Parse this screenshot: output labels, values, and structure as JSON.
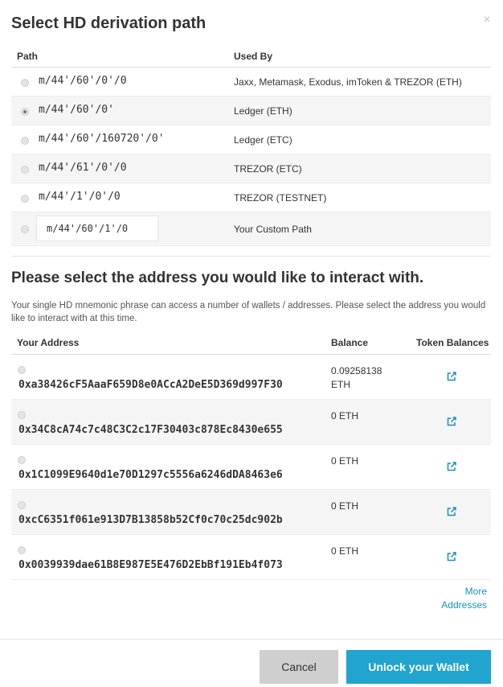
{
  "modal": {
    "title": "Select HD derivation path",
    "close_glyph": "×"
  },
  "path_table": {
    "headers": {
      "path": "Path",
      "used_by": "Used By"
    },
    "rows": [
      {
        "path": "m/44'/60'/0'/0",
        "used_by": "Jaxx, Metamask, Exodus, imToken & TREZOR (ETH)",
        "selected": false
      },
      {
        "path": "m/44'/60'/0'",
        "used_by": "Ledger (ETH)",
        "selected": true
      },
      {
        "path": "m/44'/60'/160720'/0'",
        "used_by": "Ledger (ETC)",
        "selected": false
      },
      {
        "path": "m/44'/61'/0'/0",
        "used_by": "TREZOR (ETC)",
        "selected": false
      },
      {
        "path": "m/44'/1'/0'/0",
        "used_by": "TREZOR (TESTNET)",
        "selected": false
      }
    ],
    "custom": {
      "value": "m/44'/60'/1'/0",
      "used_by": "Your Custom Path"
    }
  },
  "address_section": {
    "heading": "Please select the address you would like to interact with.",
    "description": "Your single HD mnemonic phrase can access a number of wallets / addresses. Please select the address you would like to interact with at this time.",
    "headers": {
      "address": "Your Address",
      "balance": "Balance",
      "tokens": "Token Balances"
    },
    "rows": [
      {
        "address": "0xa38426cF5AaaF659D8e0ACcA2DeE5D369d997F30",
        "balance": "0.09258138 ETH"
      },
      {
        "address": "0x34C8cA74c7c48C3C2c17F30403c878Ec8430e655",
        "balance": "0 ETH"
      },
      {
        "address": "0x1C1099E9640d1e70D1297c5556a6246dDA8463e6",
        "balance": "0 ETH"
      },
      {
        "address": "0xcC6351f061e913D7B13858b52Cf0c70c25dc902b",
        "balance": "0 ETH"
      },
      {
        "address": "0x0039939dae61B8E987E5E476D2EbBf191Eb4f073",
        "balance": "0 ETH"
      }
    ],
    "token_icon": "external-link-icon",
    "more_label": "More Addresses"
  },
  "footer": {
    "cancel_label": "Cancel",
    "unlock_label": "Unlock your Wallet"
  },
  "colors": {
    "accent": "#21a4ce",
    "link": "#1a8fc1",
    "cancel_bg": "#cfcfcf"
  }
}
